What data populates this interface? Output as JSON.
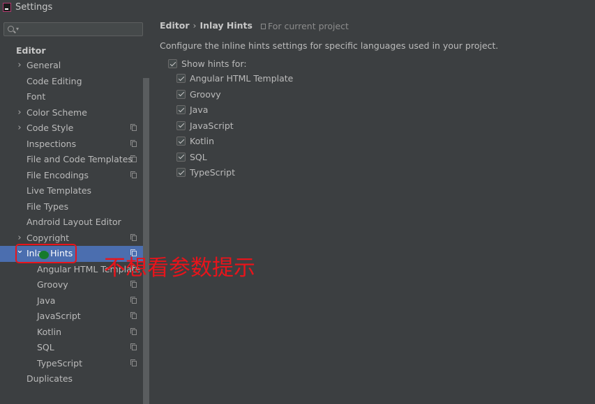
{
  "window": {
    "title": "Settings"
  },
  "sidebar": {
    "search": {
      "value": "",
      "placeholder": ""
    },
    "section_title": "Editor",
    "items": [
      {
        "label": "General",
        "indent": 1,
        "expandable": true,
        "expanded": false,
        "project_scoped": false,
        "selected": false
      },
      {
        "label": "Code Editing",
        "indent": 1,
        "expandable": false,
        "project_scoped": false,
        "selected": false
      },
      {
        "label": "Font",
        "indent": 1,
        "expandable": false,
        "project_scoped": false,
        "selected": false
      },
      {
        "label": "Color Scheme",
        "indent": 1,
        "expandable": true,
        "expanded": false,
        "project_scoped": false,
        "selected": false
      },
      {
        "label": "Code Style",
        "indent": 1,
        "expandable": true,
        "expanded": false,
        "project_scoped": true,
        "selected": false
      },
      {
        "label": "Inspections",
        "indent": 1,
        "expandable": false,
        "project_scoped": true,
        "selected": false
      },
      {
        "label": "File and Code Templates",
        "indent": 1,
        "expandable": false,
        "project_scoped": true,
        "selected": false
      },
      {
        "label": "File Encodings",
        "indent": 1,
        "expandable": false,
        "project_scoped": true,
        "selected": false
      },
      {
        "label": "Live Templates",
        "indent": 1,
        "expandable": false,
        "project_scoped": false,
        "selected": false
      },
      {
        "label": "File Types",
        "indent": 1,
        "expandable": false,
        "project_scoped": false,
        "selected": false
      },
      {
        "label": "Android Layout Editor",
        "indent": 1,
        "expandable": false,
        "project_scoped": false,
        "selected": false
      },
      {
        "label": "Copyright",
        "indent": 1,
        "expandable": true,
        "expanded": false,
        "project_scoped": true,
        "selected": false
      },
      {
        "label": "Inlay Hints",
        "indent": 1,
        "expandable": true,
        "expanded": true,
        "project_scoped": true,
        "selected": true
      },
      {
        "label": "Angular HTML Template",
        "indent": 2,
        "expandable": false,
        "project_scoped": true,
        "selected": false
      },
      {
        "label": "Groovy",
        "indent": 2,
        "expandable": false,
        "project_scoped": true,
        "selected": false
      },
      {
        "label": "Java",
        "indent": 2,
        "expandable": false,
        "project_scoped": true,
        "selected": false
      },
      {
        "label": "JavaScript",
        "indent": 2,
        "expandable": false,
        "project_scoped": true,
        "selected": false
      },
      {
        "label": "Kotlin",
        "indent": 2,
        "expandable": false,
        "project_scoped": true,
        "selected": false
      },
      {
        "label": "SQL",
        "indent": 2,
        "expandable": false,
        "project_scoped": true,
        "selected": false
      },
      {
        "label": "TypeScript",
        "indent": 2,
        "expandable": false,
        "project_scoped": true,
        "selected": false
      },
      {
        "label": "Duplicates",
        "indent": 1,
        "expandable": false,
        "project_scoped": false,
        "selected": false
      }
    ]
  },
  "breadcrumb": {
    "parent": "Editor",
    "separator": "›",
    "current": "Inlay Hints"
  },
  "scope_label": "For current project",
  "description": "Configure the inline hints settings for specific languages used in your project.",
  "show_hints": {
    "label": "Show hints for:",
    "checked": true,
    "languages": [
      {
        "label": "Angular HTML Template",
        "checked": true
      },
      {
        "label": "Groovy",
        "checked": true
      },
      {
        "label": "Java",
        "checked": true
      },
      {
        "label": "JavaScript",
        "checked": true
      },
      {
        "label": "Kotlin",
        "checked": true
      },
      {
        "label": "SQL",
        "checked": true
      },
      {
        "label": "TypeScript",
        "checked": true
      }
    ]
  },
  "annotation": {
    "text": "不想看参数提示",
    "color": "#e8141b"
  },
  "colors": {
    "background": "#3c3f41",
    "selection": "#4b6eaf",
    "text": "#bbbbbb"
  },
  "icons": {
    "app": "intellij-app-icon",
    "search": "search-icon",
    "expand": "chevron-right-icon",
    "collapse": "chevron-down-icon",
    "project_scope": "project-scope-icon"
  }
}
